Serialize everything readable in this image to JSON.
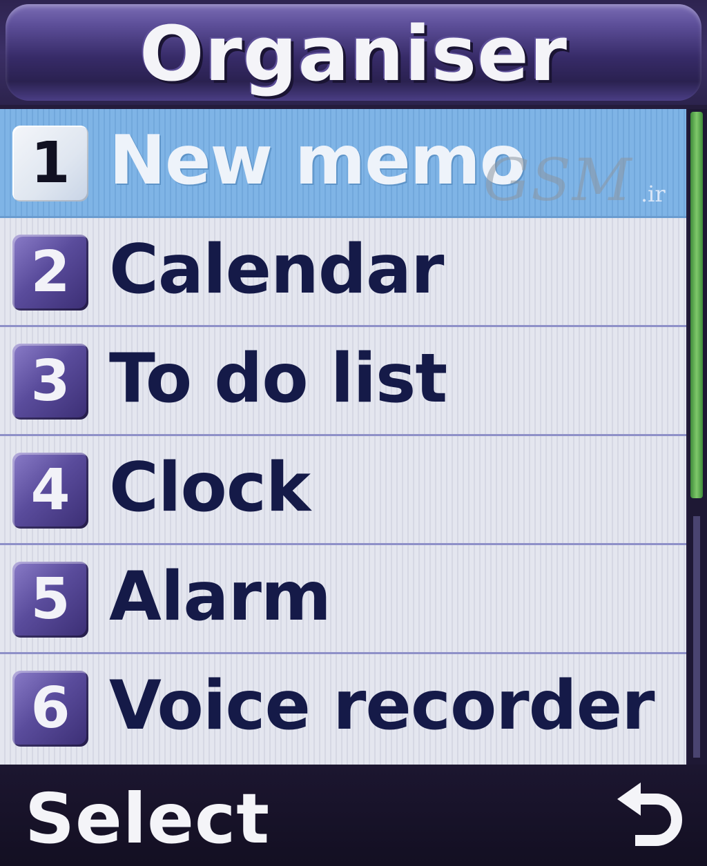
{
  "header": {
    "title": "Organiser"
  },
  "menu": {
    "selected_index": 0,
    "items": [
      {
        "number": "1",
        "label": "New memo"
      },
      {
        "number": "2",
        "label": "Calendar"
      },
      {
        "number": "3",
        "label": "To do list"
      },
      {
        "number": "4",
        "label": "Clock"
      },
      {
        "number": "5",
        "label": "Alarm"
      },
      {
        "number": "6",
        "label": "Voice recorder"
      }
    ]
  },
  "watermark": {
    "text": "GSM",
    "suffix": ".ir"
  },
  "softkeys": {
    "left_label": "Select",
    "right_icon": "back-arrow-icon"
  },
  "colors": {
    "title_bar": "#3b2f66",
    "selected_row": "#7fb4e6",
    "row_background": "#e4e6ef",
    "number_box": "#5a4c9c",
    "label_text": "#151a48",
    "scroll_thumb": "#7fc86a"
  }
}
